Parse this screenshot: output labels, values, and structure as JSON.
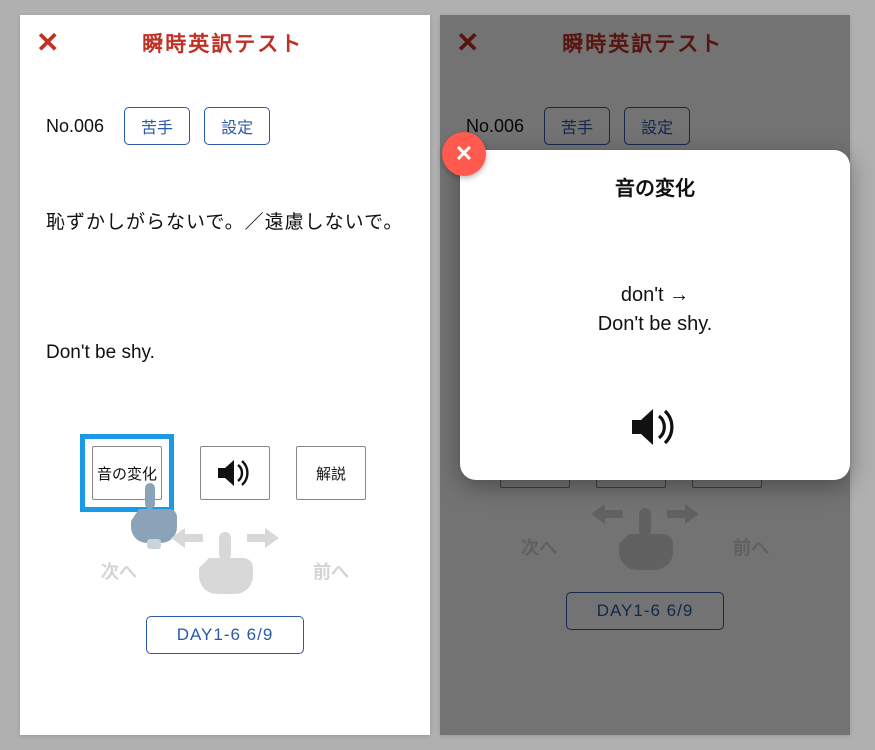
{
  "header": {
    "title": "瞬時英訳テスト"
  },
  "card": {
    "number": "No.006",
    "btn_weak": "苦手",
    "btn_settings": "設定",
    "japanese": "恥ずかしがらないで。／遠慮しないで。",
    "english": "Don't be shy."
  },
  "buttons": {
    "sound_change": "音の変化",
    "explain": "解説"
  },
  "nav": {
    "next": "次へ",
    "prev": "前へ"
  },
  "progress": "DAY1-6  6/9",
  "popup": {
    "title": "音の変化",
    "line1": "don't →",
    "line2": "Don't be shy."
  }
}
